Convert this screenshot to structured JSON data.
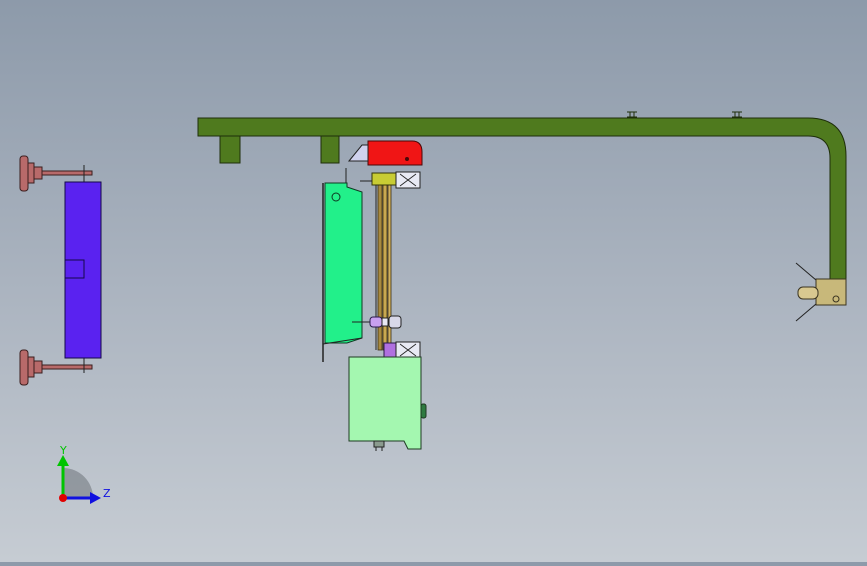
{
  "viewport": {
    "background_top": "#8d9aaa",
    "background_bottom": "#c6ccd3"
  },
  "triad": {
    "y_label": "Y",
    "z_label": "Z",
    "y_color": "#00c400",
    "z_color": "#1010e0",
    "x_color": "#e00000"
  },
  "colors": {
    "frame_arm": "#4f7a1e",
    "guard_panel": "#22f08a",
    "motor_block": "#a4f7b0",
    "red_head": "#f01515",
    "yellow_bracket": "#c8cc34",
    "blue_block": "#5a22f0",
    "feet": "#b86a6a",
    "end_bracket": "#c8b87a"
  }
}
